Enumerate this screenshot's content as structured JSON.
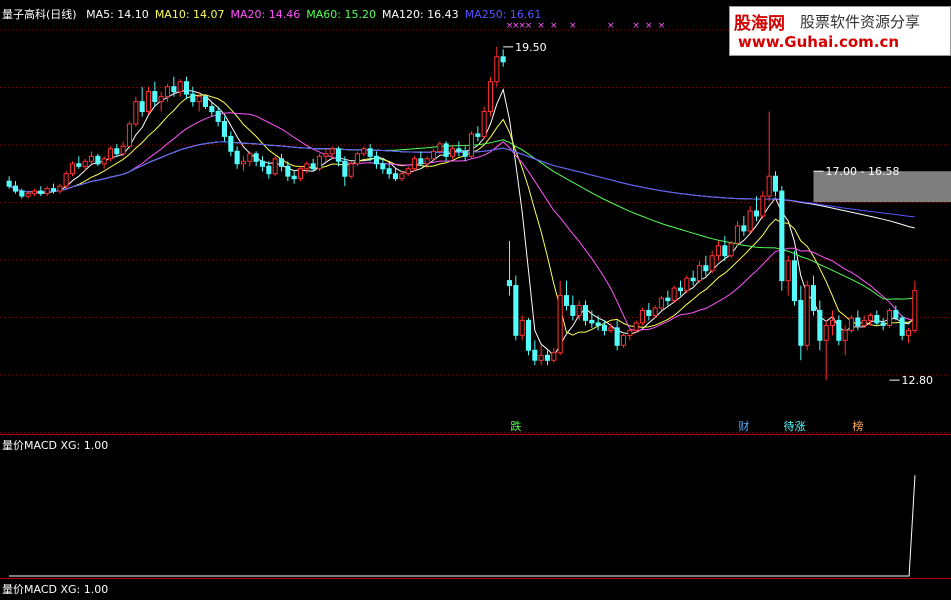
{
  "header": {
    "title": "量子高科(日线)",
    "ma_items": [
      {
        "label": "MA5: 14.10",
        "color": "#ffffff"
      },
      {
        "label": "MA10: 14.07",
        "color": "#ffff55"
      },
      {
        "label": "MA20: 14.46",
        "color": "#ff55ff"
      },
      {
        "label": "MA60: 15.20",
        "color": "#55ff55"
      },
      {
        "label": "MA120: 16.43",
        "color": "#ffffff"
      },
      {
        "label": "MA250: 16.61",
        "color": "#5555ff"
      }
    ]
  },
  "indicator_header": "量价MACD XG: 1.00",
  "footer_header": "量价MACD XG: 1.00",
  "watermark": {
    "brand": "股海网",
    "slogan": "股票软件资源分享",
    "url": "www.Guhai.com.cn"
  },
  "colors": {
    "up": "#ff3232",
    "down": "#54fcfc",
    "grid": "#8b0000",
    "ma5": "#ffffff",
    "ma10": "#ffff55",
    "ma20": "#ff55ff",
    "ma60": "#55ff55",
    "ma120": "#ffffff",
    "ma250": "#5555ff",
    "indicator": "#ffffff",
    "markers": "#ff55ff"
  },
  "chart_data": [
    {
      "type": "candlestick",
      "ylim": [
        12.3,
        20.0
      ],
      "annotations": [
        {
          "label": "19.50",
          "kind": "high",
          "index": 78,
          "value": 19.5
        },
        {
          "label": "17.00 - 16.58",
          "kind": "gap",
          "index": 127,
          "value": 17.0,
          "value2": 16.58
        },
        {
          "label": "12.80",
          "kind": "low",
          "index": 139,
          "value": 12.8
        }
      ],
      "event_labels": [
        {
          "label": "跌",
          "index": 80,
          "color": "#55ff55"
        },
        {
          "label": "财",
          "index": 116,
          "color": "#55aaff"
        },
        {
          "label": "待涨",
          "index": 124,
          "color": "#55ffff"
        },
        {
          "label": "榜",
          "index": 134,
          "color": "#ffaa55"
        }
      ],
      "marker_indices": [
        79,
        80,
        81,
        82,
        84,
        86,
        89,
        95,
        99,
        101,
        103,
        116,
        118,
        120,
        125,
        127
      ],
      "candles": [
        [
          16.8,
          16.9,
          16.65,
          16.7
        ],
        [
          16.7,
          16.8,
          16.55,
          16.6
        ],
        [
          16.6,
          16.65,
          16.45,
          16.5
        ],
        [
          16.5,
          16.6,
          16.45,
          16.55
        ],
        [
          16.55,
          16.65,
          16.5,
          16.6
        ],
        [
          16.6,
          16.7,
          16.5,
          16.55
        ],
        [
          16.55,
          16.7,
          16.5,
          16.65
        ],
        [
          16.65,
          16.75,
          16.55,
          16.6
        ],
        [
          16.6,
          16.75,
          16.55,
          16.7
        ],
        [
          16.7,
          17.0,
          16.65,
          16.95
        ],
        [
          16.95,
          17.2,
          16.9,
          17.15
        ],
        [
          17.15,
          17.3,
          17.05,
          17.1
        ],
        [
          17.1,
          17.25,
          17.0,
          17.2
        ],
        [
          17.2,
          17.4,
          17.15,
          17.3
        ],
        [
          17.3,
          17.35,
          17.1,
          17.15
        ],
        [
          17.15,
          17.3,
          17.05,
          17.25
        ],
        [
          17.25,
          17.5,
          17.2,
          17.45
        ],
        [
          17.45,
          17.55,
          17.3,
          17.35
        ],
        [
          17.35,
          17.6,
          17.3,
          17.5
        ],
        [
          17.5,
          18.0,
          17.45,
          17.95
        ],
        [
          17.95,
          18.5,
          17.9,
          18.4
        ],
        [
          18.4,
          18.7,
          18.1,
          18.2
        ],
        [
          18.2,
          18.7,
          18.15,
          18.6
        ],
        [
          18.6,
          18.8,
          18.3,
          18.4
        ],
        [
          18.4,
          18.6,
          18.2,
          18.5
        ],
        [
          18.5,
          18.75,
          18.4,
          18.7
        ],
        [
          18.7,
          18.9,
          18.5,
          18.6
        ],
        [
          18.6,
          18.85,
          18.5,
          18.8
        ],
        [
          18.8,
          18.9,
          18.45,
          18.55
        ],
        [
          18.55,
          18.7,
          18.3,
          18.4
        ],
        [
          18.4,
          18.6,
          18.2,
          18.5
        ],
        [
          18.5,
          18.55,
          18.25,
          18.3
        ],
        [
          18.3,
          18.4,
          18.1,
          18.2
        ],
        [
          18.2,
          18.3,
          17.9,
          18.0
        ],
        [
          18.0,
          18.1,
          17.6,
          17.7
        ],
        [
          17.7,
          17.8,
          17.3,
          17.4
        ],
        [
          17.4,
          17.5,
          17.05,
          17.15
        ],
        [
          17.15,
          17.3,
          17.0,
          17.2
        ],
        [
          17.2,
          17.4,
          17.1,
          17.35
        ],
        [
          17.35,
          17.4,
          17.1,
          17.2
        ],
        [
          17.2,
          17.3,
          17.0,
          17.1
        ],
        [
          17.1,
          17.2,
          16.85,
          16.95
        ],
        [
          16.95,
          17.3,
          16.9,
          17.25
        ],
        [
          17.25,
          17.35,
          17.0,
          17.1
        ],
        [
          17.1,
          17.2,
          16.8,
          16.9
        ],
        [
          16.9,
          17.0,
          16.75,
          16.85
        ],
        [
          16.85,
          17.1,
          16.8,
          17.05
        ],
        [
          17.05,
          17.2,
          16.95,
          17.15
        ],
        [
          17.15,
          17.25,
          17.0,
          17.05
        ],
        [
          17.05,
          17.35,
          17.0,
          17.3
        ],
        [
          17.3,
          17.45,
          17.2,
          17.35
        ],
        [
          17.35,
          17.5,
          17.25,
          17.45
        ],
        [
          17.45,
          17.5,
          17.1,
          17.2
        ],
        [
          17.2,
          17.3,
          16.7,
          16.9
        ],
        [
          16.9,
          17.2,
          16.85,
          17.15
        ],
        [
          17.15,
          17.4,
          17.1,
          17.35
        ],
        [
          17.35,
          17.5,
          17.3,
          17.45
        ],
        [
          17.45,
          17.55,
          17.2,
          17.3
        ],
        [
          17.3,
          17.4,
          17.05,
          17.15
        ],
        [
          17.15,
          17.25,
          16.95,
          17.05
        ],
        [
          17.05,
          17.15,
          16.85,
          16.95
        ],
        [
          16.95,
          17.05,
          16.8,
          16.85
        ],
        [
          16.85,
          17.0,
          16.8,
          16.95
        ],
        [
          16.95,
          17.1,
          16.9,
          17.05
        ],
        [
          17.05,
          17.3,
          17.0,
          17.25
        ],
        [
          17.25,
          17.4,
          17.1,
          17.15
        ],
        [
          17.15,
          17.3,
          17.05,
          17.25
        ],
        [
          17.25,
          17.45,
          17.2,
          17.4
        ],
        [
          17.4,
          17.6,
          17.35,
          17.55
        ],
        [
          17.55,
          17.6,
          17.2,
          17.3
        ],
        [
          17.3,
          17.5,
          17.25,
          17.45
        ],
        [
          17.45,
          17.6,
          17.3,
          17.4
        ],
        [
          17.4,
          17.5,
          17.2,
          17.3
        ],
        [
          17.3,
          17.8,
          17.25,
          17.75
        ],
        [
          17.75,
          17.9,
          17.6,
          17.7
        ],
        [
          17.7,
          18.3,
          17.65,
          18.2
        ],
        [
          18.2,
          18.9,
          18.1,
          18.8
        ],
        [
          18.8,
          19.5,
          18.7,
          19.3
        ],
        [
          19.3,
          19.45,
          19.1,
          19.2
        ],
        [
          14.8,
          15.6,
          14.5,
          14.7
        ],
        [
          14.7,
          14.9,
          13.6,
          13.7
        ],
        [
          13.7,
          14.1,
          13.6,
          14.0
        ],
        [
          14.0,
          14.05,
          13.3,
          13.4
        ],
        [
          13.4,
          13.6,
          13.1,
          13.2
        ],
        [
          13.2,
          13.5,
          13.1,
          13.3
        ],
        [
          13.3,
          13.4,
          13.1,
          13.2
        ],
        [
          13.2,
          13.45,
          13.15,
          13.35
        ],
        [
          13.35,
          14.8,
          13.3,
          14.5
        ],
        [
          14.5,
          14.8,
          14.2,
          14.3
        ],
        [
          14.3,
          14.5,
          14.0,
          14.1
        ],
        [
          14.1,
          14.4,
          14.0,
          14.3
        ],
        [
          14.3,
          14.4,
          13.9,
          14.0
        ],
        [
          14.0,
          14.2,
          13.85,
          13.95
        ],
        [
          13.95,
          14.1,
          13.8,
          13.9
        ],
        [
          13.9,
          14.0,
          13.7,
          13.8
        ],
        [
          13.8,
          13.95,
          13.75,
          13.85
        ],
        [
          13.85,
          14.0,
          13.4,
          13.5
        ],
        [
          13.5,
          13.75,
          13.45,
          13.7
        ],
        [
          13.7,
          13.85,
          13.6,
          13.8
        ],
        [
          13.8,
          14.0,
          13.75,
          13.95
        ],
        [
          13.95,
          14.25,
          13.9,
          14.2
        ],
        [
          14.2,
          14.35,
          14.0,
          14.1
        ],
        [
          14.1,
          14.3,
          14.05,
          14.25
        ],
        [
          14.25,
          14.5,
          14.2,
          14.45
        ],
        [
          14.45,
          14.6,
          14.3,
          14.4
        ],
        [
          14.4,
          14.7,
          14.35,
          14.65
        ],
        [
          14.65,
          14.8,
          14.5,
          14.6
        ],
        [
          14.6,
          14.9,
          14.55,
          14.85
        ],
        [
          14.85,
          15.0,
          14.7,
          14.8
        ],
        [
          14.8,
          15.2,
          14.75,
          15.1
        ],
        [
          15.1,
          15.3,
          14.9,
          15.0
        ],
        [
          15.0,
          15.4,
          14.95,
          15.3
        ],
        [
          15.3,
          15.6,
          15.2,
          15.5
        ],
        [
          15.5,
          15.7,
          15.2,
          15.3
        ],
        [
          15.3,
          15.6,
          15.25,
          15.55
        ],
        [
          15.55,
          16.0,
          15.5,
          15.9
        ],
        [
          15.9,
          16.1,
          15.7,
          15.8
        ],
        [
          15.8,
          16.3,
          15.75,
          16.2
        ],
        [
          16.2,
          16.5,
          16.0,
          16.1
        ],
        [
          16.1,
          16.6,
          16.05,
          16.5
        ],
        [
          16.5,
          18.2,
          16.4,
          16.9
        ],
        [
          16.9,
          17.0,
          16.5,
          16.6
        ],
        [
          16.6,
          16.7,
          14.6,
          14.8
        ],
        [
          14.8,
          15.3,
          14.5,
          15.2
        ],
        [
          15.2,
          15.4,
          14.3,
          14.4
        ],
        [
          14.4,
          14.7,
          13.2,
          13.5
        ],
        [
          13.5,
          14.8,
          13.4,
          14.7
        ],
        [
          14.7,
          14.9,
          14.1,
          14.2
        ],
        [
          14.2,
          14.4,
          13.4,
          13.6
        ],
        [
          13.6,
          14.0,
          12.8,
          13.9
        ],
        [
          13.9,
          14.2,
          13.7,
          14.0
        ],
        [
          14.0,
          14.1,
          13.5,
          13.6
        ],
        [
          13.6,
          13.9,
          13.3,
          13.8
        ],
        [
          13.8,
          14.1,
          13.75,
          14.05
        ],
        [
          14.05,
          14.2,
          13.8,
          13.9
        ],
        [
          13.9,
          14.1,
          13.85,
          14.0
        ],
        [
          14.0,
          14.15,
          13.9,
          14.1
        ],
        [
          14.1,
          14.2,
          13.9,
          13.95
        ],
        [
          13.95,
          14.05,
          13.8,
          13.9
        ],
        [
          13.9,
          14.25,
          13.85,
          14.2
        ],
        [
          14.2,
          14.3,
          14.0,
          14.05
        ],
        [
          14.05,
          14.1,
          13.6,
          13.7
        ],
        [
          13.7,
          13.85,
          13.55,
          13.8
        ],
        [
          13.8,
          14.8,
          13.75,
          14.6
        ]
      ]
    },
    {
      "type": "line",
      "title": "量价MACD XG: 1.00",
      "ylim": [
        0,
        1.2
      ],
      "series": [
        {
          "values": [
            0,
            0,
            0,
            0,
            0,
            0,
            0,
            0,
            0,
            0,
            0,
            0,
            0,
            0,
            0,
            0,
            0,
            0,
            0,
            0,
            0,
            0,
            0,
            0,
            0,
            0,
            0,
            0,
            0,
            0,
            0,
            0,
            0,
            0,
            0,
            0,
            0,
            0,
            0,
            0,
            0,
            0,
            0,
            0,
            0,
            0,
            0,
            0,
            0,
            0,
            0,
            0,
            0,
            0,
            0,
            0,
            0,
            0,
            0,
            0,
            0,
            0,
            0,
            0,
            0,
            0,
            0,
            0,
            0,
            0,
            0,
            0,
            0,
            0,
            0,
            0,
            0,
            0,
            0,
            0,
            0,
            0,
            0,
            0,
            0,
            0,
            0,
            0,
            0,
            0,
            0,
            0,
            0,
            0,
            0,
            0,
            0,
            0,
            0,
            0,
            0,
            0,
            0,
            0,
            0,
            0,
            0,
            0,
            0,
            0,
            0,
            0,
            0,
            0,
            0,
            0,
            0,
            0,
            0,
            0,
            0,
            0,
            0,
            0,
            0,
            0,
            0,
            0,
            0,
            0,
            0,
            0,
            0,
            0,
            0,
            0,
            0,
            0,
            0,
            0,
            0,
            0,
            0,
            0,
            0,
            0,
            0,
            0,
            0,
            0,
            0,
            0,
            0,
            1
          ]
        }
      ]
    }
  ]
}
